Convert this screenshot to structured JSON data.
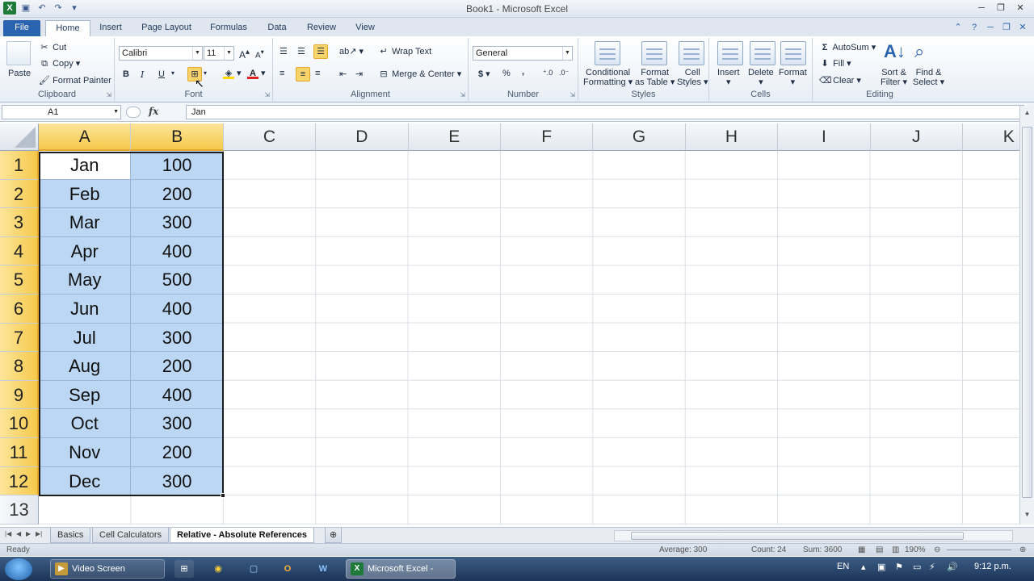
{
  "window": {
    "title": "Book1 - Microsoft Excel"
  },
  "tabs": [
    "File",
    "Home",
    "Insert",
    "Page Layout",
    "Formulas",
    "Data",
    "Review",
    "View"
  ],
  "ribbon": {
    "clipboard": {
      "label": "Clipboard",
      "paste": "Paste",
      "cut": "Cut",
      "copy": "Copy",
      "format_painter": "Format Painter"
    },
    "font": {
      "label": "Font",
      "name": "Calibri",
      "size": "11",
      "bold": "B",
      "italic": "I",
      "underline": "U"
    },
    "alignment": {
      "label": "Alignment",
      "wrap": "Wrap Text",
      "merge": "Merge & Center"
    },
    "number": {
      "label": "Number",
      "format": "General",
      "currency": "$",
      "percent": "%",
      "comma": ","
    },
    "styles": {
      "label": "Styles",
      "conditional_1": "Conditional",
      "conditional_2": "Formatting",
      "format_table_1": "Format",
      "format_table_2": "as Table",
      "cell_styles_1": "Cell",
      "cell_styles_2": "Styles"
    },
    "cells": {
      "label": "Cells",
      "insert": "Insert",
      "delete": "Delete",
      "format": "Format"
    },
    "editing": {
      "label": "Editing",
      "autosum": "AutoSum",
      "fill": "Fill",
      "clear": "Clear",
      "sort_1": "Sort &",
      "sort_2": "Filter",
      "find_1": "Find &",
      "find_2": "Select"
    }
  },
  "formula_bar": {
    "name_box": "A1",
    "fx": "fx",
    "value": "Jan"
  },
  "columns": [
    "A",
    "B",
    "C",
    "D",
    "E",
    "F",
    "G",
    "H",
    "I",
    "J",
    "K"
  ],
  "rows": [
    "1",
    "2",
    "3",
    "4",
    "5",
    "6",
    "7",
    "8",
    "9",
    "10",
    "11",
    "12",
    "13"
  ],
  "data": [
    [
      "Jan",
      "100"
    ],
    [
      "Feb",
      "200"
    ],
    [
      "Mar",
      "300"
    ],
    [
      "Apr",
      "400"
    ],
    [
      "May",
      "500"
    ],
    [
      "Jun",
      "400"
    ],
    [
      "Jul",
      "300"
    ],
    [
      "Aug",
      "200"
    ],
    [
      "Sep",
      "400"
    ],
    [
      "Oct",
      "300"
    ],
    [
      "Nov",
      "200"
    ],
    [
      "Dec",
      "300"
    ]
  ],
  "sheets": [
    "Basics",
    "Cell Calculators",
    "Relative - Absolute References"
  ],
  "active_sheet": "Relative - Absolute References",
  "status": {
    "ready": "Ready",
    "average": "Average: 300",
    "count": "Count: 24",
    "sum": "Sum: 3600",
    "zoom": "190%"
  },
  "taskbar": {
    "items": [
      "Video Screen Capture",
      "Microsoft Excel - Bo..."
    ],
    "lang": "EN",
    "time": "9:12 p.m."
  },
  "colors": {
    "accent": "#2a64b1",
    "selection": "#bcd7f3",
    "header_selected": "#f5c94b"
  }
}
